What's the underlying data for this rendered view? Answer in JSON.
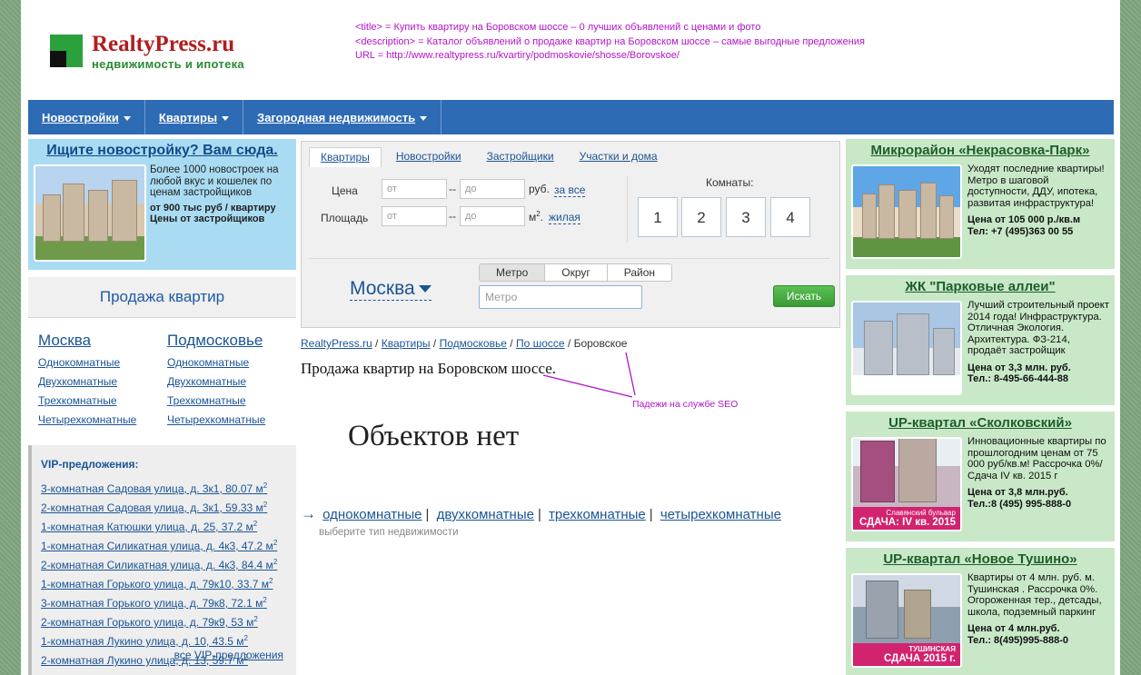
{
  "header": {
    "logo_name": "RealtyPress.ru",
    "logo_sub": "недвижимость и ипотека",
    "seo_title": "<title> = Купить квартиру на Боровском шоссе – 0 лучших объявлений с ценами и фото",
    "seo_description": "<description> = Каталог объявлений о продаже квартир на Боровском шоссе – самые выгодные предложения",
    "seo_url": "URL = http://www.realtypress.ru/kvartiry/podmoskovie/shosse/Borovskoe/"
  },
  "nav": {
    "items": [
      "Новостройки",
      "Квартиры",
      "Загородная недвижимость"
    ]
  },
  "left_ad": {
    "title": "Ищите новостройку? Вам сюда.",
    "text": "Более 1000 новостроек на любой вкус и кошелек по ценам застройщиков",
    "bold1": "от 900 тыс руб / квартиру",
    "bold2": "Цены от застройщиков"
  },
  "sales": {
    "title": "Продажа квартир",
    "regions": [
      {
        "title": "Москва",
        "links": [
          "Однокомнатные",
          "Двухкомнатные",
          "Трехкомнатные",
          "Четырехкомнатные"
        ]
      },
      {
        "title": "Подмосковье",
        "links": [
          "Однокомнатные",
          "Двухкомнатные",
          "Трехкомнатные",
          "Четырехкомнатные"
        ]
      }
    ]
  },
  "vip": {
    "title": "VIP-предложения:",
    "items": [
      "3-комнатная Садовая улица, д. 3к1, 80.07 м",
      "2-комнатная Садовая улица, д. 3к1, 59.33 м",
      "1-комнатная Катюшки улица, д. 25, 37.2 м",
      "1-комнатная Силикатная улица, д. 4к3, 47.2 м",
      "2-комнатная Силикатная улица, д. 4к3, 84.4 м",
      "1-комнатная Горького улица, д. 79к10, 33.7 м",
      "3-комнатная Горького улица, д. 79к8, 72.1 м",
      "2-комнатная Горького улица, д. 79к9, 53 м",
      "1-комнатная Лукино улица, д. 10, 43.5 м",
      "2-комнатная Лукино улица, д. 13, 59.7 м"
    ],
    "sup": "2",
    "all_link": "все VIP-предложения"
  },
  "search": {
    "tabs": [
      "Квартиры",
      "Новостройки",
      "Застройщики",
      "Участки и дома"
    ],
    "price_label": "Цена",
    "area_label": "Площадь",
    "from_ph": "от",
    "to_ph": "до",
    "dash": "--",
    "price_unit": "руб.",
    "price_scope": "за все",
    "area_unit": "м",
    "area_unit_sup": "2",
    "area_unit_dot": ".",
    "area_scope": "жилая",
    "rooms_label": "Комнаты:",
    "rooms": [
      "1",
      "2",
      "3",
      "4"
    ],
    "city": "Москва",
    "modes": [
      "Метро",
      "Округ",
      "Район"
    ],
    "metro_ph": "Метро",
    "find": "Искать"
  },
  "content": {
    "crumbs": [
      "RealtyPress.ru",
      "Квартиры",
      "Подмосковье",
      "По шоссе"
    ],
    "crumb_current": "Боровское",
    "crumb_sep": "/",
    "h1": "Продажа квартир на Боровском шоссе.",
    "annotation": "Падежи на службе SEO",
    "no_objects": "Объектов нет",
    "arrow": "→",
    "types": [
      "однокомнатные",
      "двухкомнатные",
      "трехкомнатные",
      "четырехкомнатные"
    ],
    "pipe": "|",
    "types_hint": "выберите тип недвижимости"
  },
  "right_ads": [
    {
      "title": "Микрорайон «Некрасовка-Парк»",
      "text": "Уходят последние квартиры! Метро в шаговой доступности, ДДУ, ипотека, развитая инфраструктура!",
      "price": "Цена от 105 000 р./кв.м",
      "phone": "Тел: +7 (495)363 00 55"
    },
    {
      "title": "ЖК \"Парковые аллеи\"",
      "text": "Лучший строительный проект 2014 года! Инфраструктура. Отличная Экология. Архитектура. ФЗ-214, продаёт застройщик",
      "price": "Цена от 3,3 млн. руб.",
      "phone": "Тел.: 8-495-66-444-88"
    },
    {
      "title": "UP-квартал «Сколковский»",
      "text": "Инновационные квартиры по прошлогодним ценам от 75 000 руб/кв.м! Рассрочка 0%/ Сдача IV кв. 2015 г",
      "price": "Цена от 3,8 млн.руб.",
      "phone": "Тел.:8 (495) 995-888-0",
      "caption_small": "Славянский бульвар",
      "caption": "СДАЧА: IV кв. 2015"
    },
    {
      "title": "UP-квартал «Новое Тушино»",
      "text": "Квартиры от 4 млн. руб. м. Тушинская . Рассрочка 0%. Огороженная тер., детсады, школа, подземный паркинг",
      "price": "Цена от 4 млн.руб.",
      "phone": "Тел.: 8(495)995-888-0",
      "caption_small": "ТУШИНСКАЯ",
      "caption": "СДАЧА 2015 г."
    }
  ]
}
